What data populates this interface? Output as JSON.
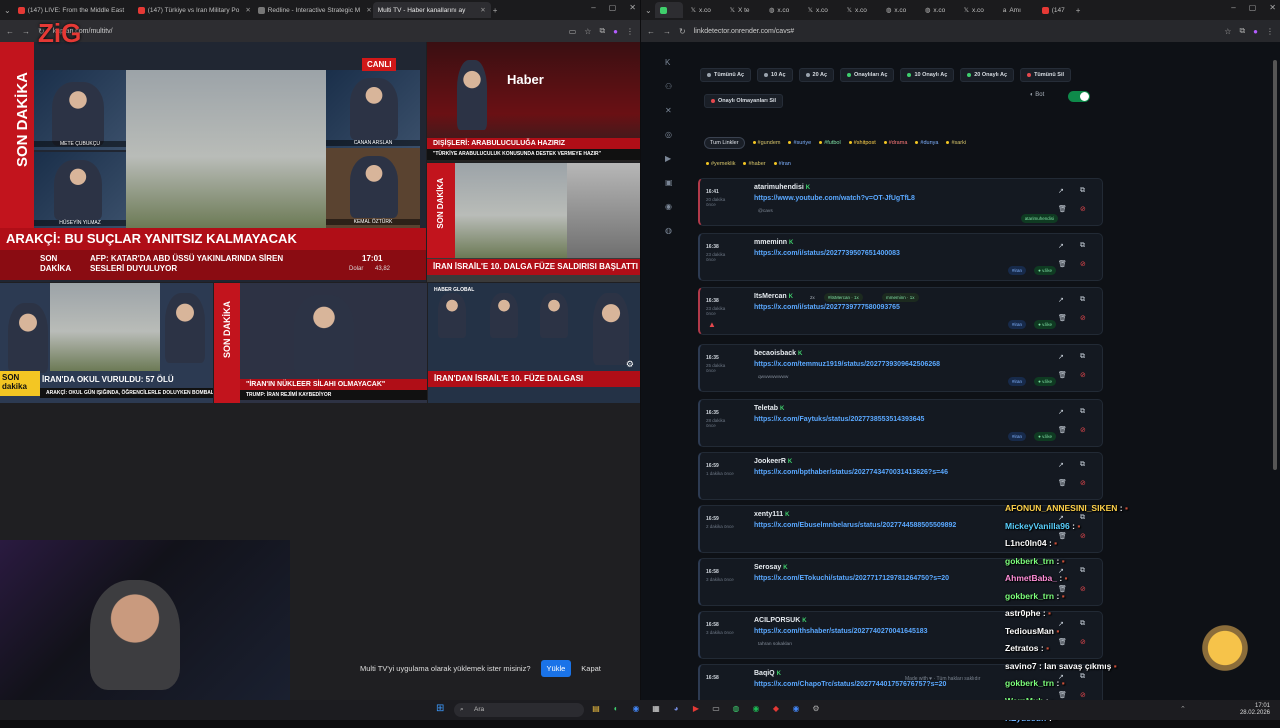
{
  "left_browser": {
    "tabs": [
      {
        "label": "(147) LIVE: From the Middle East"
      },
      {
        "label": "(147) Türkiye vs Iran Military Po"
      },
      {
        "label": "Redline - Interactive Strategic M"
      },
      {
        "label": "Multi TV - Haber kanallarını ay"
      }
    ],
    "url": "kaplan.com/multitv/",
    "tv": {
      "canli_badge": "CANLI",
      "son_dakika": "SON DAKİKA",
      "headline_main": "ARAKÇİ: BU SUÇLAR YANITSIZ KALMAYACAK",
      "ticker_label": "SON DAKİKA",
      "ticker_text": "AFP: KATAR'DA ABD ÜSSÜ YAKINLARINDA SİREN SESLERİ DUYULUYOR",
      "ticker_time": "17:01",
      "ticker_dolar": "Dolar",
      "ticker_dolar_value": "43,82",
      "names": [
        "METE ÇUBUKÇU",
        "HÜSEYİN YILMAZ",
        "CANAN ARSLAN",
        "KEMAL ÖZTÜRK"
      ],
      "haber_logo": "Haber",
      "disisleri": "DIŞİŞLERİ: ARABULUCULUĞA HAZIRIZ",
      "disisleri_sub": "\"TÜRKİYE ARABULUCULUK KONUSUNDA DESTEK VERMEYE HAZIR\"",
      "iran_israil": "İRAN İSRAİL'E 10. DALGA FÜZE SALDIRISI BAŞLATTI",
      "okul": "İRAN'DA OKUL VURULDU: 57 ÖLÜ",
      "okul_sub": "ARAKÇİ: OKUL GÜN IŞIĞINDA, ÖĞRENCİLERLE DOLUYKEN BOMBALANDI",
      "nukleer": "\"İRAN'IN NÜKLEER SİLAHI OLMAYACAK\"",
      "nukleer_sub": "TRUMP: İRAN REJİMİ KAYBEDİYOR",
      "iran_dan": "İRAN'DAN İSRAİL'E 10. FÜZE DALGASI",
      "son_label": "SON",
      "dakika_label": "dakika",
      "haber_global": "HABER GLOBAL"
    },
    "install_prompt": "Multi TV'yi uygulama olarak yüklemek ister misiniz?",
    "install_button": "Yükle",
    "dismiss_button": "Kapat"
  },
  "right_browser": {
    "tabs": [
      "x.co",
      "X te",
      "x.co",
      "x.co",
      "x.co",
      "x.co",
      "x.co",
      "x.co",
      "Amı",
      "(147"
    ],
    "url": "linkdetector.onrender.com/cavs#",
    "filters": [
      {
        "label": "Tümünü Aç",
        "dot": "#9aa3ad"
      },
      {
        "label": "10 Aç",
        "dot": "#9aa3ad"
      },
      {
        "label": "20 Aç",
        "dot": "#9aa3ad"
      },
      {
        "label": "Onaylıları Aç",
        "dot": "#3ecf6e"
      },
      {
        "label": "10 Onaylı Aç",
        "dot": "#3ecf6e"
      },
      {
        "label": "20 Onaylı Aç",
        "dot": "#3ecf6e"
      },
      {
        "label": "Tümünü Sil",
        "dot": "#e5484d"
      }
    ],
    "delete_unverified": "Onaylı Olmayanları Sil",
    "bot_label": "Bot",
    "tags": [
      "Tum Linkler",
      "#gundem",
      "#suriye",
      "#futbol",
      "#shitpost",
      "#drama",
      "#dunya",
      "#sarki",
      "#yemeklik",
      "#haber",
      "#iran"
    ],
    "cards": [
      {
        "time": "16:41",
        "ago": "20 dakika önce",
        "user": "atarimuhendisi",
        "link": "https://www.youtube.com/watch?v=OT-JfUgTfL8",
        "note": "@cavs",
        "tag": "atarimuhendisi"
      },
      {
        "time": "16:38",
        "ago": "23 dakika önce",
        "user": "mmeminn",
        "link": "https://x.com/i/status/2027739507651400083",
        "tag": "#iran",
        "vote": "vlike"
      },
      {
        "time": "16:38",
        "ago": "23 dakika önce",
        "user": "ItsMercan",
        "multi": "2x",
        "extra1": "#itsMercan · 1x",
        "extra2": "mmeminn · 1x",
        "link": "https://x.com/i/status/2027739777580093765",
        "tag": "#iran",
        "vote": "vlike"
      },
      {
        "time": "16:35",
        "ago": "25 dakika önce",
        "user": "becaoisback",
        "link": "https://x.com/temmuz1919/status/2027739309642506268",
        "note": "qwwwwwwww",
        "tag": "#iran",
        "vote": "vlike"
      },
      {
        "time": "16:35",
        "ago": "28 dakika önce",
        "user": "Teletab",
        "link": "https://x.com/Faytuks/status/2027738553514393645",
        "tag": "#iran",
        "vote": "vlike"
      },
      {
        "time": "16:59",
        "ago": "1 dakika önce",
        "user": "JookeerR",
        "link": "https://x.com/bpthaber/status/2027743470031413626?s=46"
      },
      {
        "time": "16:59",
        "ago": "2 dakika önce",
        "user": "xenty111",
        "link": "https://x.com/Ebuselmnbelarus/status/2027744588505509892"
      },
      {
        "time": "16:58",
        "ago": "3 dakika önce",
        "user": "Serosay",
        "link": "https://x.com/ETokuchi/status/2027717129781264750?s=20"
      },
      {
        "time": "16:58",
        "ago": "3 dakika önce",
        "user": "ACILPORSUK",
        "link": "https://x.com/thshaber/status/2027740270041645183",
        "note": "tahran sokakları"
      },
      {
        "time": "16:58",
        "ago": "",
        "user": "BaqiQ",
        "link": "https://x.com/ChapoTrc/status/202774401757676757?s=20"
      }
    ],
    "made_with": "Made with ♥ · Tüm hakları saklıdır",
    "chat": [
      {
        "name": "AFONUN_ANNESINI_SIKEN",
        "msg": ":",
        "color": "#ffd24a"
      },
      {
        "name": "MickeyVanilla96",
        "msg": ":",
        "color": "#5ad1ff"
      },
      {
        "name": "L1nc0ln04",
        "msg": ":",
        "color": "#ffffff"
      },
      {
        "name": "gokberk_trn",
        "msg": ":",
        "color": "#7dff7d"
      },
      {
        "name": "AhmetBaba_",
        "msg": ":",
        "color": "#ff8fd8"
      },
      {
        "name": "gokberk_trn",
        "msg": ":",
        "color": "#7dff7d"
      },
      {
        "name": "astr0phe",
        "msg": ":",
        "color": "#ffffff"
      },
      {
        "name": "TediousMan",
        "msg": "",
        "color": "#ffffff"
      },
      {
        "name": "Zetratos",
        "msg": ":",
        "color": "#ffffff"
      },
      {
        "name": "savino7",
        "msg": ": Ian savaş çıkmış",
        "color": "#ffffff"
      },
      {
        "name": "gokberk_trn",
        "msg": ":",
        "color": "#7dff7d"
      },
      {
        "name": "WarpMub",
        "msg": ":",
        "color": "#7dff7d"
      },
      {
        "name": "HZyussuff",
        "msg": ":",
        "color": "#6fb3ff"
      }
    ]
  },
  "taskbar": {
    "search_placeholder": "Ara",
    "time": "17:01",
    "date": "28.02.2026"
  },
  "logo": "ZiG"
}
